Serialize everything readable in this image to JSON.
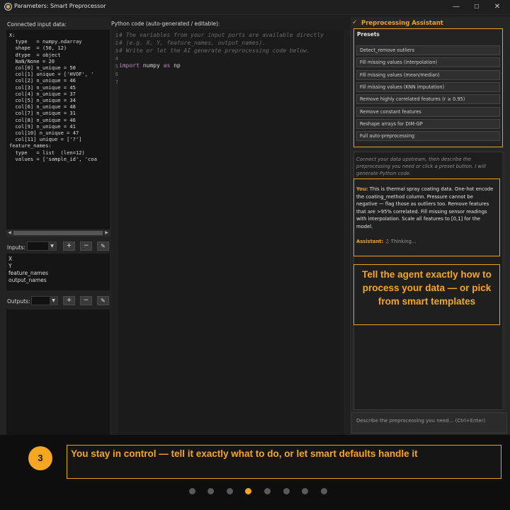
{
  "window": {
    "title": "Parameters: Smart Preprocessor",
    "minimize": "—",
    "maximize": "☐",
    "close": "✕"
  },
  "left": {
    "connected_label": "Connected input data:",
    "data_text": "X:\n  type   = numpy.ndarray\n  shape  = (50, 12)\n  dtype  = object\n  NaN/None = 20\n  col[0] n_unique = 50\n  col[1] unique = ['HVOF', '\n  col[2] n_unique = 46\n  col[3] n_unique = 45\n  col[4] n_unique = 37\n  col[5] n_unique = 34\n  col[6] n_unique = 48\n  col[7] n_unique = 31\n  col[8] n_unique = 46\n  col[9] n_unique = 41\n  col[10] n_unique = 47\n  col[11] unique = ['?']\nfeature_names:\n  type   = list  (len=12)\n  values = ['sample_id', 'coa",
    "inputs_label": "Inputs:",
    "outputs_label": "Outputs:",
    "plus": "+",
    "minus": "−",
    "edit": "✎",
    "inputs": [
      "X",
      "Y",
      "feature_names",
      "output_names"
    ]
  },
  "code": {
    "label": "Python code (auto-generated / editable):",
    "line1": "# The variables from your input ports are available directly",
    "line2": "# (e.g. X, Y, feature_names, output_names).",
    "line3": "# Write or let the AI generate preprocessing code below.",
    "line5_kw1": "import",
    "line5_id": " numpy ",
    "line5_kw2": "as",
    "line5_id2": " np",
    "line_numbers": [
      "1",
      "2",
      "3",
      "4",
      "5",
      "6",
      "7"
    ]
  },
  "assistant": {
    "title": "Preprocessing Assistant",
    "presets_label": "Presets",
    "presets": [
      "Detect_remove outliers",
      "Fill missing values (interpolation)",
      "Fill missing values (mean/median)",
      "Fill missing values (KNN imputation)",
      "Remove highly correlated features (r ≥ 0.95)",
      "Remove constant features",
      "Reshape arrays for DIM-GP",
      "Full auto-preprocessing"
    ],
    "hint": "Connect your data upstream, then describe the preprocessing you need or click a preset button. I will generate Python code.",
    "you_label": "You:",
    "you_message": " This is thermal spray coating data. One-hot encode the coating_method column. Pressure cannot be negative — flag those as outliers too. Remove features that are >95% correlated. Fill missing sensor readings with interpolation. Scale all features to [0,1] for the model.",
    "assistant_label": "Assistant:",
    "assistant_message": " ♫ Thinking...",
    "callout": "Tell the agent exactly how to process your data — or pick from smart templates",
    "input_placeholder": "Describe the preprocessing you need...  (Ctrl+Enter)"
  },
  "footer": {
    "step_number": "3",
    "step_text": "You stay in control — tell it exactly what to do, or let smart defaults handle it",
    "dots_total": 8,
    "active_dot": 4
  },
  "colors": {
    "accent": "#f5a623",
    "background": "#1e1e1e"
  }
}
